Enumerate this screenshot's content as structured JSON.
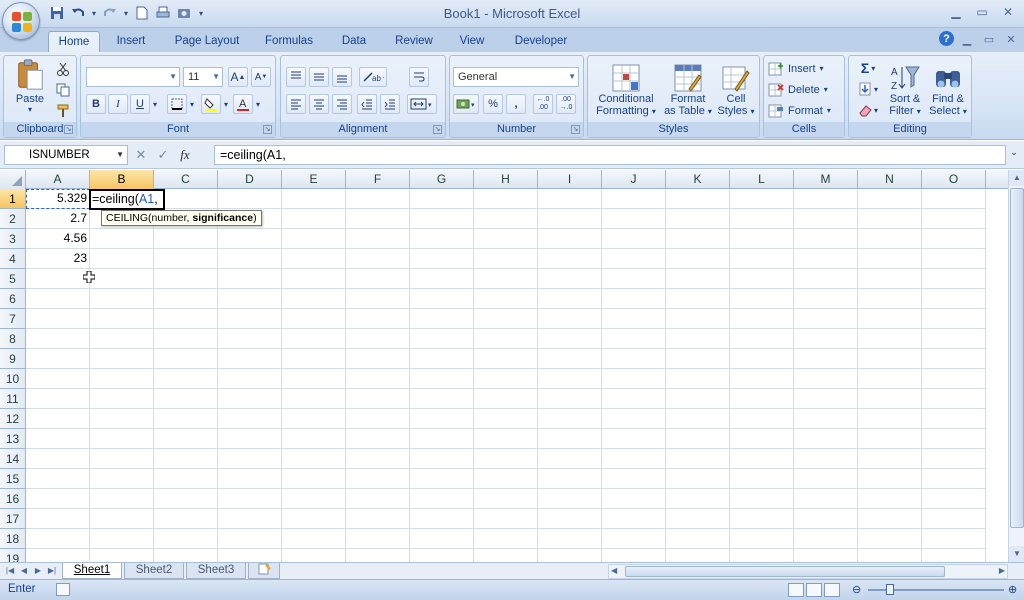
{
  "window": {
    "title": "Book1 - Microsoft Excel"
  },
  "quick_access": {
    "icons": [
      "save-icon",
      "undo-icon",
      "redo-icon",
      "new-icon",
      "print-preview-icon",
      "camera-icon",
      "customize-icon"
    ]
  },
  "ribbon_tabs": [
    "Home",
    "Insert",
    "Page Layout",
    "Formulas",
    "Data",
    "Review",
    "View",
    "Developer"
  ],
  "active_tab": "Home",
  "ribbon": {
    "clipboard": {
      "label": "Clipboard",
      "paste": "Paste"
    },
    "font": {
      "label": "Font",
      "font_name": "",
      "font_size": "11",
      "bold": "B",
      "italic": "I",
      "underline": "U"
    },
    "alignment": {
      "label": "Alignment"
    },
    "number": {
      "label": "Number",
      "format": "General",
      "percent": "%",
      "comma": ","
    },
    "styles": {
      "label": "Styles",
      "conditional_1": "Conditional",
      "conditional_2": "Formatting",
      "format_table_1": "Format",
      "format_table_2": "as Table",
      "cell_styles_1": "Cell",
      "cell_styles_2": "Styles"
    },
    "cells": {
      "label": "Cells",
      "insert": "Insert",
      "delete": "Delete",
      "format": "Format"
    },
    "editing": {
      "label": "Editing",
      "sum": "Σ",
      "sort_1": "Sort &",
      "sort_2": "Filter",
      "find_1": "Find &",
      "find_2": "Select"
    }
  },
  "formula_bar": {
    "name_box": "ISNUMBER",
    "fx": "fx",
    "formula": "=ceiling(A1,"
  },
  "columns": [
    "A",
    "B",
    "C",
    "D",
    "E",
    "F",
    "G",
    "H",
    "I",
    "J",
    "K",
    "L",
    "M",
    "N",
    "O"
  ],
  "rows": [
    "1",
    "2",
    "3",
    "4",
    "5",
    "6",
    "7",
    "8",
    "9",
    "10",
    "11",
    "12",
    "13",
    "14",
    "15",
    "16",
    "17",
    "18",
    "19"
  ],
  "cells": {
    "A1": "5.329",
    "A2": "2.7",
    "A3": "4.56",
    "A4": "23",
    "B1_prefix": "=ceiling(",
    "B1_ref": "A1",
    "B1_suffix": ","
  },
  "tooltip": {
    "func": "CEILING(",
    "arg1": "number, ",
    "arg2": "significance",
    "close": ")"
  },
  "sheet_tabs": [
    "Sheet1",
    "Sheet2",
    "Sheet3"
  ],
  "active_sheet": "Sheet1",
  "status": {
    "mode": "Enter"
  },
  "colors": {
    "ribbon_bg": "#dce8f7",
    "header_selected": "#f7c462",
    "accent": "#15428b"
  }
}
